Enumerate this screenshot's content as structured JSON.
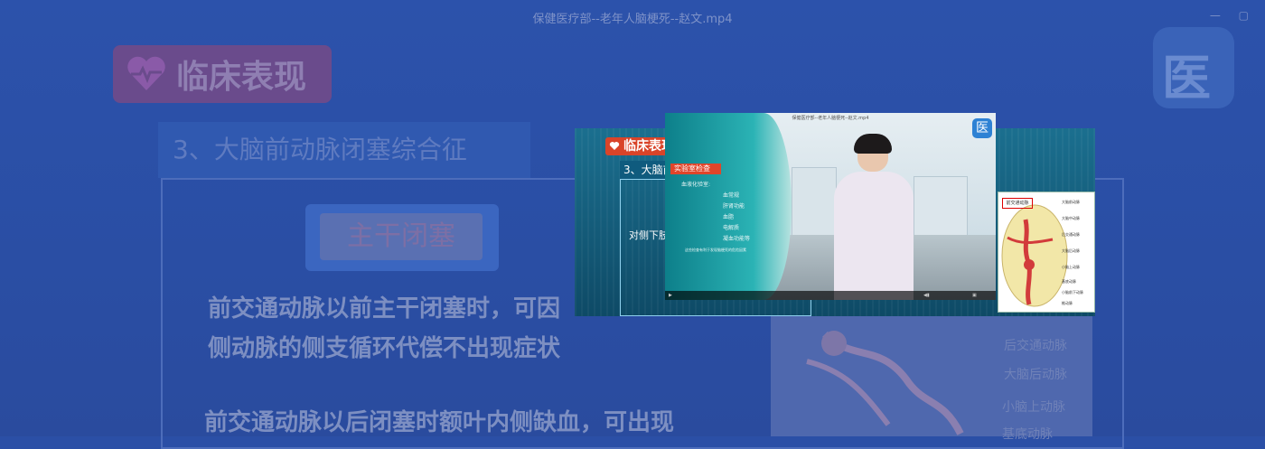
{
  "background": {
    "window_title": "保健医疗部--老年人脑梗死--赵文.mp4",
    "window_controls": "— ▢",
    "badge_label": "临床表现",
    "logo_glyph": "医",
    "section_heading": "3、大脑前动脉闭塞综合征",
    "main_block_label": "主干闭塞",
    "paragraph_1_line_1": "前交通动脉以前主干闭塞时，可因",
    "paragraph_1_line_2": "侧动脉的侧支循环代偿不出现症状",
    "paragraph_2": "前交通动脉以后闭塞时额叶内侧缺血，可出现",
    "diagram_labels": [
      "后交通动脉",
      "大脑后动脉",
      "小脑上动脉",
      "基底动脉"
    ]
  },
  "foreground": {
    "badge_label": "临床表现",
    "heading": "3、大脑前",
    "side_text": "对侧下肢",
    "video": {
      "title": "保健医疗部--老年人脑梗死--赵文.mp4",
      "logo_glyph": "医",
      "board_badge": "实验室检查",
      "board_items": [
        "血液化验室:",
        "血常规",
        "肝肾功能",
        "血脂",
        "电解质",
        "凝血功能等"
      ],
      "board_note": "这些检查有利于发现脑梗死的危险因素"
    },
    "diagram": {
      "highlight_label": "前交通动脉",
      "labels": [
        "大脑前动脉",
        "大脑中动脉",
        "后交通动脉",
        "大脑后动脉",
        "小脑上动脉",
        "基底动脉",
        "小脑前下动脉",
        "椎动脉"
      ]
    }
  },
  "colors": {
    "bg": "#2b4fa6",
    "badge_red": "#d94429",
    "panel_teal": "#1b6f8f"
  }
}
